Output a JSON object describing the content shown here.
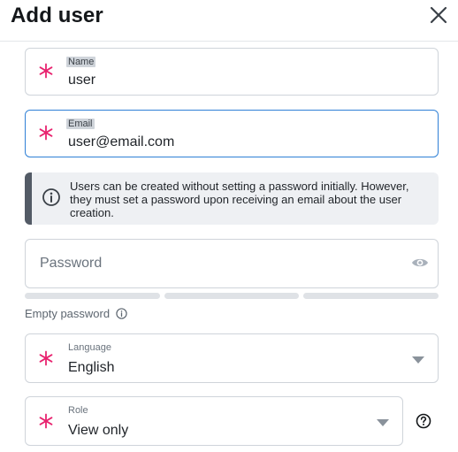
{
  "header": {
    "title": "Add user",
    "close_icon": "close-icon"
  },
  "fields": {
    "name": {
      "label": "Name",
      "value": "user",
      "required": true
    },
    "email": {
      "label": "Email",
      "value": "user@email.com",
      "required": true,
      "focused": true
    },
    "password": {
      "placeholder": "Password",
      "value": "",
      "visibility_icon": "eye-icon"
    },
    "language": {
      "label": "Language",
      "value": "English",
      "required": true
    },
    "role": {
      "label": "Role",
      "value": "View only",
      "required": true
    }
  },
  "info_message": "Users can be created without setting a password initially. However, they must set a password upon receiving an email about the user creation.",
  "password_strength": {
    "segments": 3,
    "filled": 0
  },
  "empty_password_label": "Empty password",
  "colors": {
    "required": "#e8236f",
    "focus_border": "#2f80d6",
    "info_bar": "#535b66",
    "info_bg": "#eef0f3",
    "strength_empty": "#dfe2e6"
  }
}
